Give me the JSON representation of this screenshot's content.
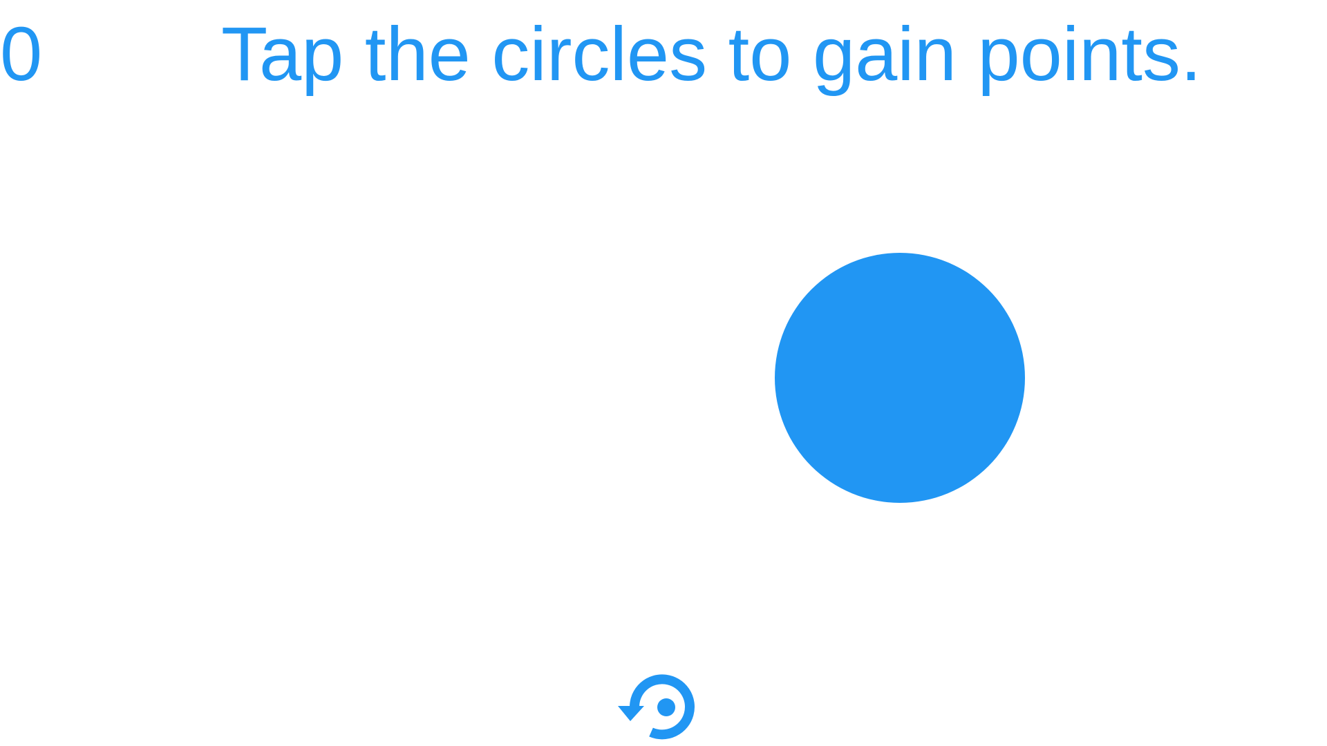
{
  "game": {
    "score": "0",
    "instruction": "Tap the circles to gain points."
  },
  "target": {
    "icon": "circle-target",
    "color": "#2196f3"
  },
  "controls": {
    "restart_icon": "restart-icon"
  },
  "colors": {
    "accent": "#2196f3",
    "background": "#ffffff"
  }
}
